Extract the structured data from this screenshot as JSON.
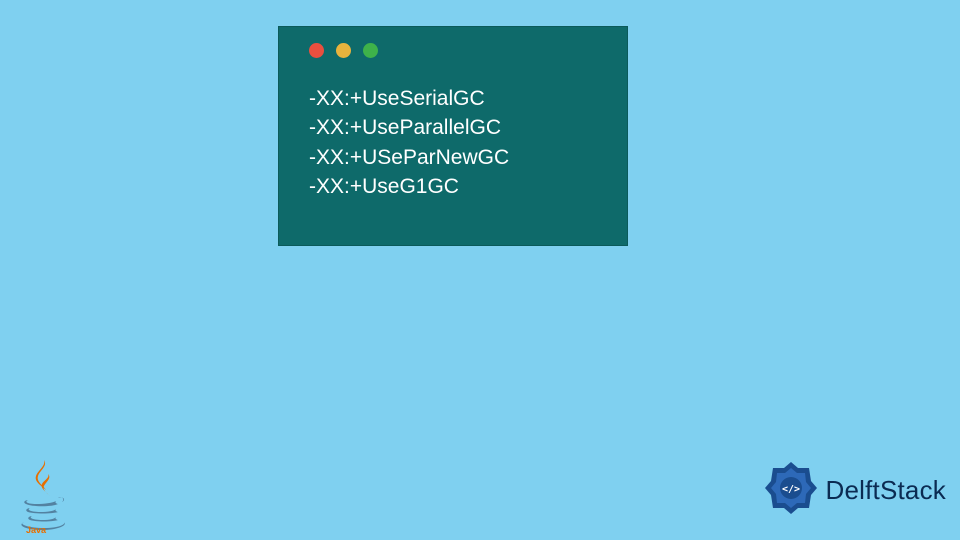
{
  "code_lines": [
    "-XX:+UseSerialGC",
    "-XX:+UseParallelGC",
    "-XX:+USeParNewGC",
    "-XX:+UseG1GC"
  ],
  "branding": {
    "delft": "DelftStack",
    "java": "Java"
  },
  "window_dots": [
    "red",
    "yellow",
    "green"
  ]
}
